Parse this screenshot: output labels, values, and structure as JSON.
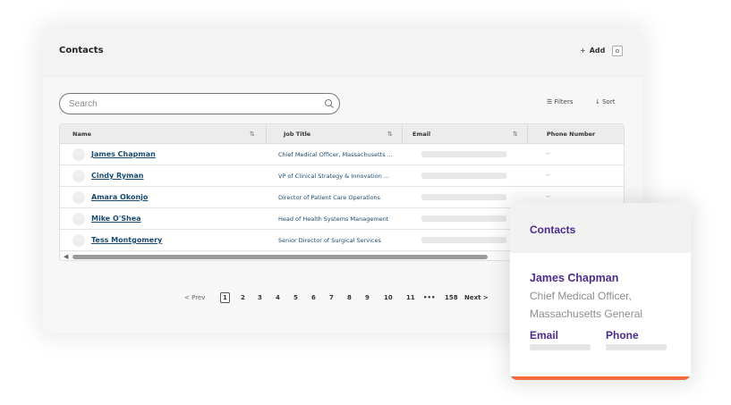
{
  "main": {
    "title": "Contacts",
    "add_label": "Add",
    "add_prefix": "+",
    "search": {
      "placeholder": "Search"
    },
    "filters_label": "Filters",
    "sort_label": "Sort",
    "columns": [
      "Name",
      "Job Title",
      "Email",
      "Phone Number"
    ],
    "rows": [
      {
        "name": "James Chapman",
        "job": "Chief Medical Officer, Massachusetts ...",
        "phone": "--"
      },
      {
        "name": "Cindy Ryman",
        "job": "VP of Clinical Strategy & Innovation ...",
        "phone": "--"
      },
      {
        "name": "Amara Okonjo",
        "job": "Director of Patient Care Operations",
        "phone": "--"
      },
      {
        "name": "Mike O'Shea",
        "job": "Head of Health Systems Management",
        "phone": "--"
      },
      {
        "name": "Tess Montgomery",
        "job": "Senior Director of Surgical Services",
        "phone": "--"
      }
    ]
  },
  "pagination": {
    "prev": "< Prev",
    "next": "Next >",
    "pages": [
      "1",
      "2",
      "3",
      "4",
      "5",
      "6",
      "7",
      "8",
      "9",
      "10",
      "11",
      "•••",
      "158"
    ],
    "current": "1"
  },
  "detail_card": {
    "title": "Contacts",
    "name": "James Chapman",
    "job": "Chief Medical Officer, Massachusetts General",
    "email_label": "Email",
    "phone_label": "Phone",
    "accent_color": "#f26a3d",
    "text_color": "#4a2c8a"
  }
}
